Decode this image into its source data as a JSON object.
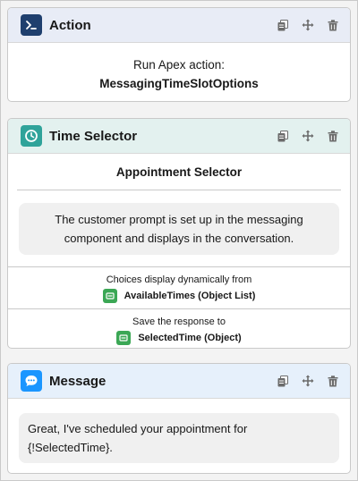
{
  "colors": {
    "action_icon_bg": "#1f3f6e",
    "time_icon_bg": "#2fa39a",
    "message_icon_bg": "#1b96ff",
    "pill_green": "#3ba755",
    "tool_gray": "#6b6b6b"
  },
  "action_card": {
    "title": "Action",
    "icon": "terminal-prompt-icon",
    "line1": "Run Apex action:",
    "line2": "MessagingTimeSlotOptions",
    "tools": [
      "copy-icon",
      "move-icon",
      "delete-icon"
    ]
  },
  "time_card": {
    "title": "Time Selector",
    "icon": "clock-icon",
    "selector_title": "Appointment Selector",
    "prompt": "The customer prompt is set up in the messaging component and displays in the conversation.",
    "choices_label": "Choices display dynamically from",
    "choices_value": "AvailableTimes (Object List)",
    "save_label": "Save the response to",
    "save_value": "SelectedTime (Object)",
    "tools": [
      "copy-icon",
      "move-icon",
      "delete-icon"
    ]
  },
  "message_card": {
    "title": "Message",
    "icon": "chat-bubble-icon",
    "text": "Great, I've scheduled your appointment for {!SelectedTime}.",
    "tools": [
      "copy-icon",
      "move-icon",
      "delete-icon"
    ]
  }
}
